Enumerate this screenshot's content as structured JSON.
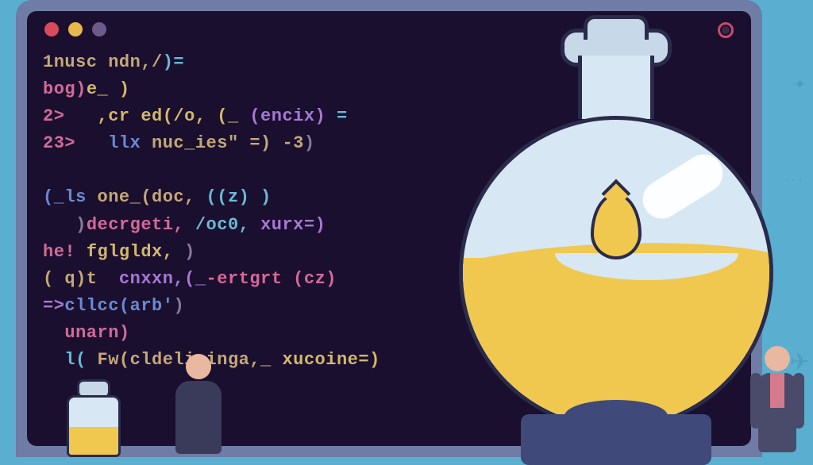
{
  "code": {
    "l1a": "1nusc ndn,/",
    "l1b": ")=",
    "l2a": "bog)",
    "l2b": "e_ )",
    "l3a": "   ,cr ed(/o, (_ ",
    "l3b": "(encix)",
    "l3c": " =",
    "l3p": "2>",
    "l4a": "   llx ",
    "l4b": "nuc_ies\" =) -3",
    "l4c": ")",
    "l4p": "23>",
    "l6a": "(_ls ",
    "l6b": "one_(doc,",
    "l6c": " ((z) )",
    "l7a": "   )",
    "l7b": "decrgeti,",
    "l7c": " /oc0, ",
    "l7d": "xurx=)",
    "l8a": "he! ",
    "l8b": "fglgldx,",
    "l8c": " )",
    "l9a": "( q)t  ",
    "l9b": "cnxxn,(_",
    "l9c": "-ertgrt (cz)",
    "l10a": "=>",
    "l10b": "cllcc(arb'",
    "l10c": ")",
    "l11a": "  unarn)",
    "l12a": "  l( ",
    "l12b": "Fw(cldelicinga,_",
    "l12c": " xucoine=)"
  }
}
